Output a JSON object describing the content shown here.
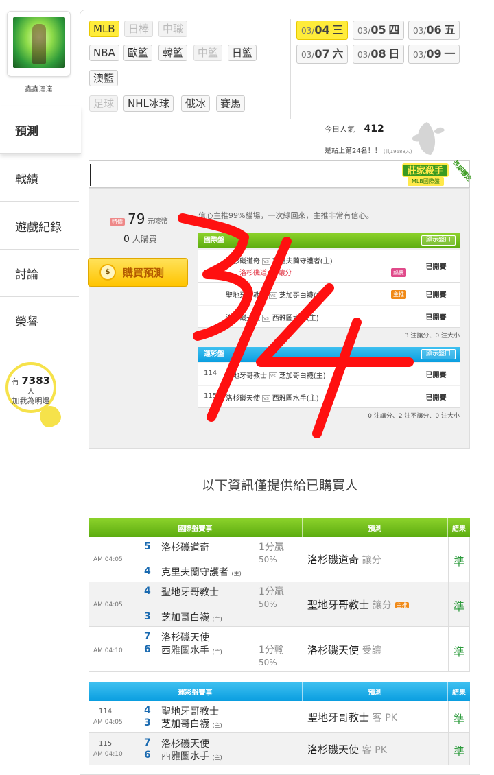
{
  "profile": {
    "username": "鑫鑫達達"
  },
  "nav": [
    {
      "label": "預測"
    },
    {
      "label": "戰績"
    },
    {
      "label": "遊戲紀錄"
    },
    {
      "label": "討論"
    },
    {
      "label": "榮譽"
    }
  ],
  "fans": {
    "prefix": "有",
    "count": "7383",
    "suffix": "人",
    "cta": "加我為明燈"
  },
  "leagues": [
    {
      "label": "MLB",
      "state": "selected"
    },
    {
      "label": "日棒",
      "state": "disabled"
    },
    {
      "label": "中職",
      "state": "disabled"
    },
    {
      "label": "NBA",
      "state": "normal"
    },
    {
      "label": "歐籃",
      "state": "normal"
    },
    {
      "label": "韓籃",
      "state": "normal"
    },
    {
      "label": "中籃",
      "state": "disabled"
    },
    {
      "label": "日籃",
      "state": "normal"
    },
    {
      "label": "澳籃",
      "state": "normal"
    },
    {
      "label": "足球",
      "state": "disabled"
    },
    {
      "label": "NHL冰球",
      "state": "normal"
    },
    {
      "label": "俄冰",
      "state": "normal"
    },
    {
      "label": "賽馬",
      "state": "normal"
    }
  ],
  "dates": [
    {
      "month": "03/",
      "day": "04",
      "weekday": "三",
      "selected": true
    },
    {
      "month": "03/",
      "day": "05",
      "weekday": "四"
    },
    {
      "month": "03/",
      "day": "06",
      "weekday": "五"
    },
    {
      "month": "03/",
      "day": "07",
      "weekday": "六"
    },
    {
      "month": "03/",
      "day": "08",
      "weekday": "日"
    },
    {
      "month": "03/",
      "day": "09",
      "weekday": "一"
    }
  ],
  "stats": {
    "pop_label": "今日人氣",
    "pop_value": "412",
    "rank_text": "是站上第24名！！",
    "rank_total": "(共19688人)"
  },
  "badge": {
    "line1": "莊家殺手",
    "line2": "MLB國際盤",
    "ribbon": "長期穩定"
  },
  "offer": {
    "tag": "特價",
    "price": "79",
    "unit": "元嘜幣",
    "buyers": "0",
    "buyers_suffix": "人購買",
    "buy_button": "購買預測",
    "confidence": "信心主推99%貓場，一次綠回來，主推非常有信心。"
  },
  "preview": {
    "intl": {
      "title": "國際盤",
      "show": "顯示盤口",
      "rows": [
        {
          "away": "洛杉磯道奇",
          "home": "克里夫蘭守護者(主)",
          "pick": "洛杉磯道奇",
          "pick_type": "讓分",
          "tag": "熱賣",
          "result": "已開賽"
        },
        {
          "away": "聖地牙哥教士",
          "home": "芝加哥白襪(主)",
          "tag": "主推",
          "result": "已開賽"
        },
        {
          "away": "洛杉磯天使",
          "home": "西雅圖水手(主)",
          "result": "已開賽"
        }
      ],
      "summary": "3 注讓分、0 注大小"
    },
    "sports": {
      "title": "運彩盤",
      "show": "顯示盤口",
      "rows": [
        {
          "no": "114",
          "away": "聖地牙哥教士",
          "home": "芝加哥白襪(主)",
          "result": "已開賽"
        },
        {
          "no": "115",
          "away": "洛杉磯天使",
          "home": "西雅圖水手(主)",
          "result": "已開賽"
        }
      ],
      "summary": "0 注讓分、2 注不讓分、0 注大小"
    }
  },
  "info_title": "以下資訊僅提供給已購買人",
  "intl_table": {
    "headers": [
      "國際盤賽事",
      "預測",
      "結果"
    ],
    "rows": [
      {
        "time": "AM 04:05",
        "away_score": "5",
        "away": "洛杉磯道奇",
        "home_score": "4",
        "home": "克里夫蘭守護者",
        "home_mark": "(主)",
        "odds1": "1分贏",
        "odds2": "50%",
        "pick": "洛杉磯道奇",
        "pick_type": "讓分",
        "result": "準"
      },
      {
        "time": "AM 04:05",
        "away_score": "4",
        "away": "聖地牙哥教士",
        "home_score": "3",
        "home": "芝加哥白襪",
        "home_mark": "(主)",
        "odds1": "1分贏",
        "odds2": "50%",
        "pick": "聖地牙哥教士",
        "pick_type": "讓分",
        "pick_tag": "主推",
        "result": "準"
      },
      {
        "time": "AM 04:10",
        "away_score": "7",
        "away": "洛杉磯天使",
        "home_score": "6",
        "home": "西雅圖水手",
        "home_mark": "(主)",
        "odds1": "1分輸",
        "odds2": "50%",
        "pick": "洛杉磯天使",
        "pick_type": "受讓",
        "result": "準"
      }
    ]
  },
  "sports_table": {
    "headers": [
      "運彩盤賽事",
      "預測",
      "結果"
    ],
    "rows": [
      {
        "no": "114",
        "time": "AM 04:05",
        "away_score": "4",
        "away": "聖地牙哥教士",
        "home_score": "3",
        "home": "芝加哥白襪",
        "home_mark": "(主)",
        "pick": "聖地牙哥教士",
        "pick_type": "客 PK",
        "result": "準"
      },
      {
        "no": "115",
        "time": "AM 04:10",
        "away_score": "7",
        "away": "洛杉磯天使",
        "home_score": "6",
        "home": "西雅圖水手",
        "home_mark": "(主)",
        "pick": "洛杉磯天使",
        "pick_type": "客 PK",
        "result": "準"
      }
    ]
  },
  "overlay": {
    "text": "3/14",
    "color": "#ff1010"
  }
}
